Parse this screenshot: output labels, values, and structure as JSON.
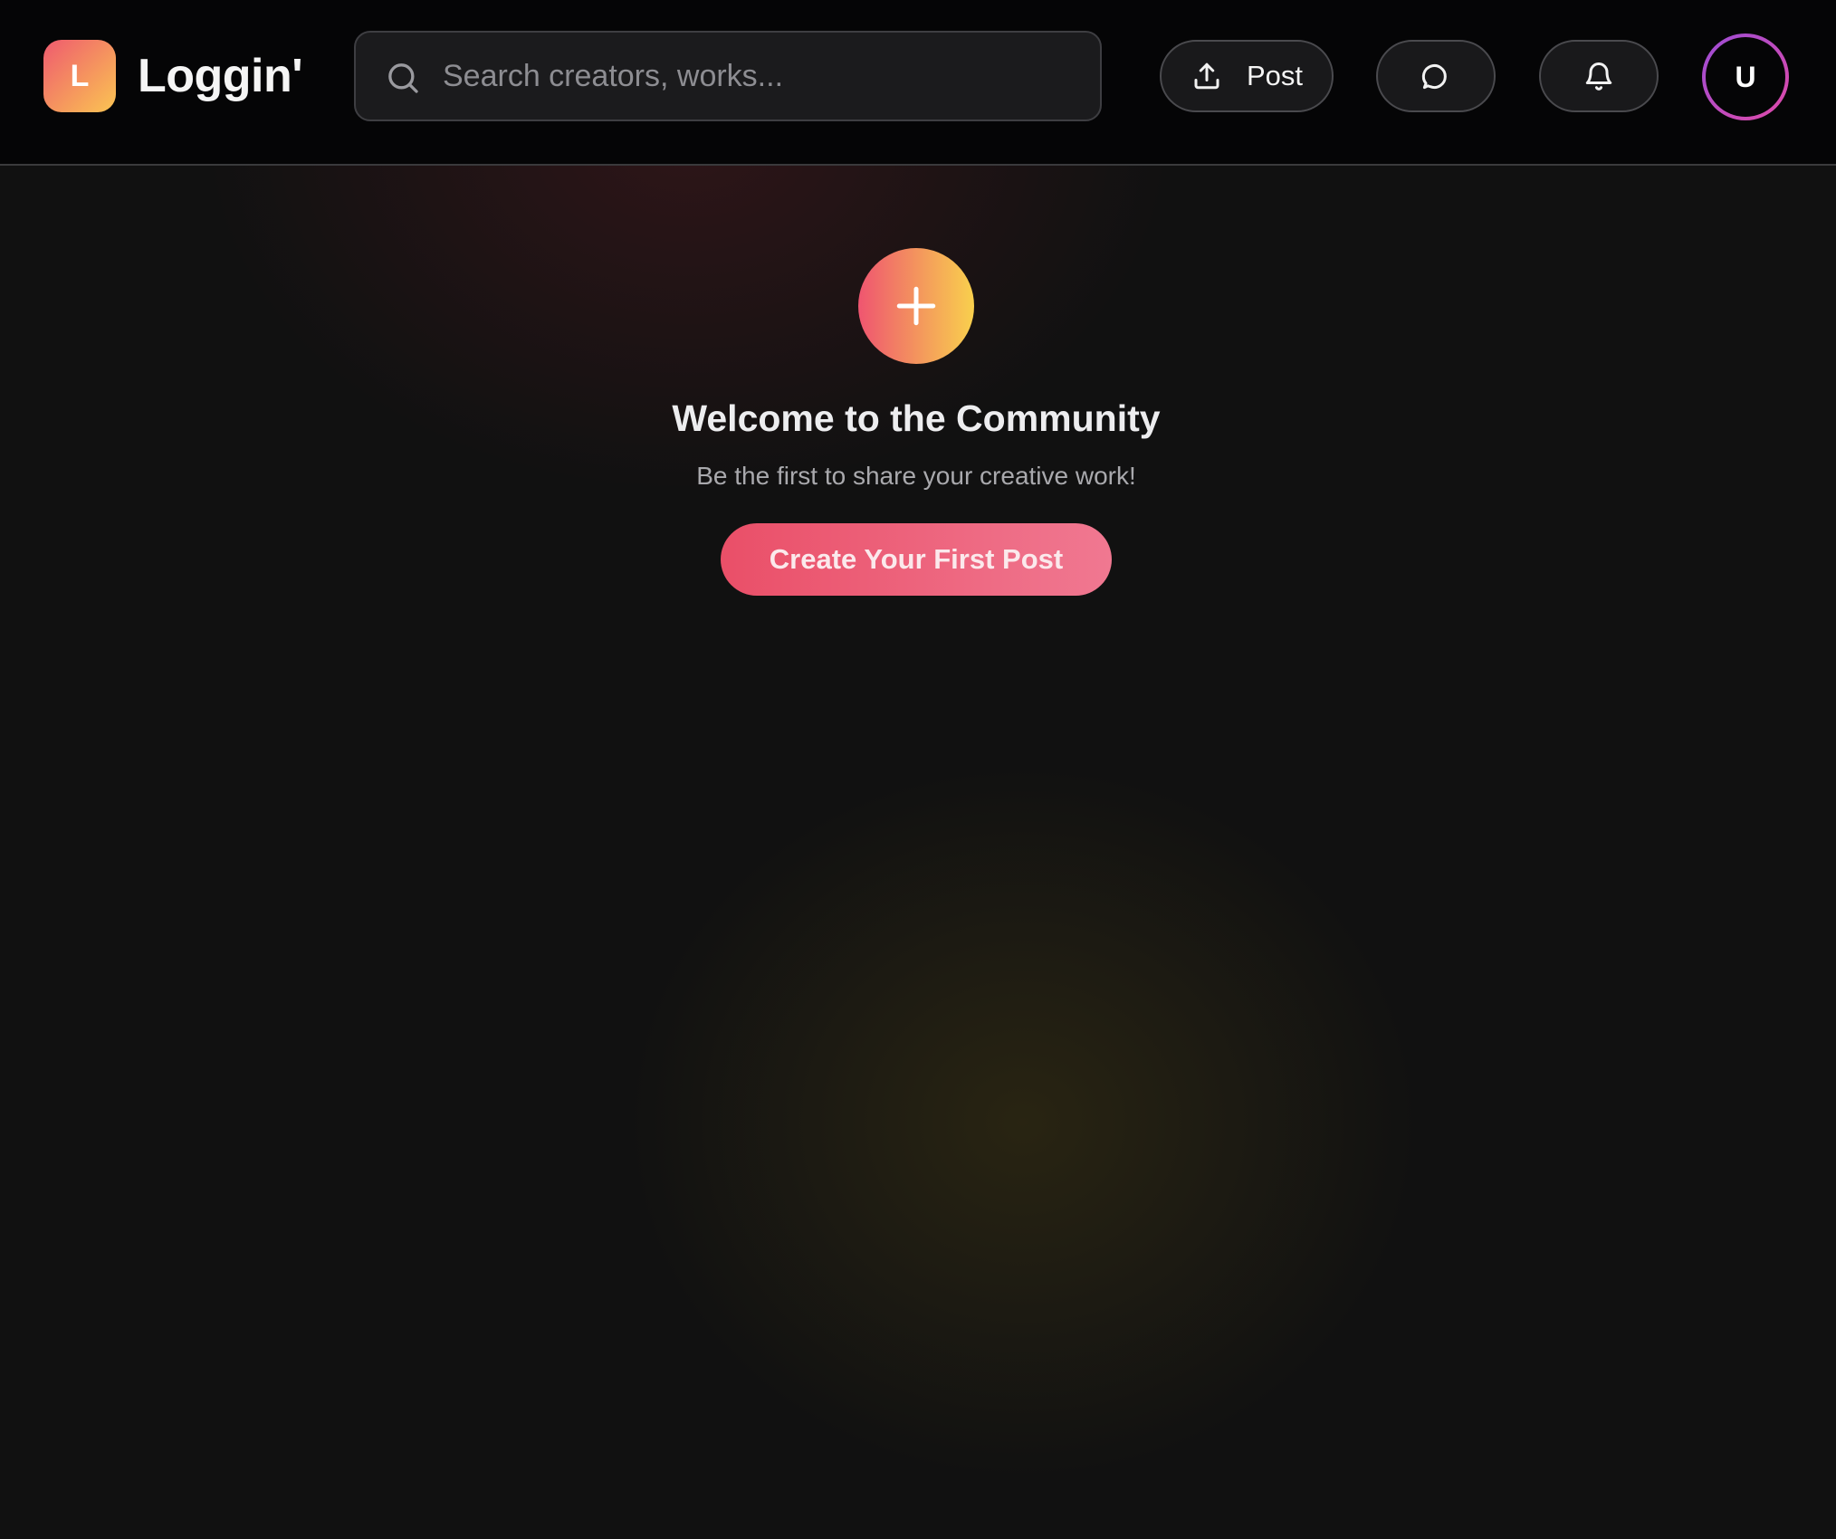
{
  "header": {
    "logo_letter": "L",
    "app_name": "Loggin'",
    "search": {
      "placeholder": "Search creators, works...",
      "value": ""
    },
    "post_button_label": "Post",
    "avatar_initial": "U"
  },
  "icons": {
    "search": "search-icon",
    "post": "upload-icon",
    "messages": "chat-bubble-icon",
    "notifications": "bell-icon",
    "create": "plus-icon"
  },
  "empty_state": {
    "title": "Welcome to the Community",
    "subtitle": "Be the first to share your creative work!",
    "cta_label": "Create Your First Post"
  },
  "colors": {
    "brand_gradient_start": "#ef5a6f",
    "brand_gradient_end": "#fbc553",
    "cta": "#ea4f68",
    "avatar_ring": "#b94ccf",
    "header_bg": "#050506",
    "page_bg": "#111111"
  }
}
